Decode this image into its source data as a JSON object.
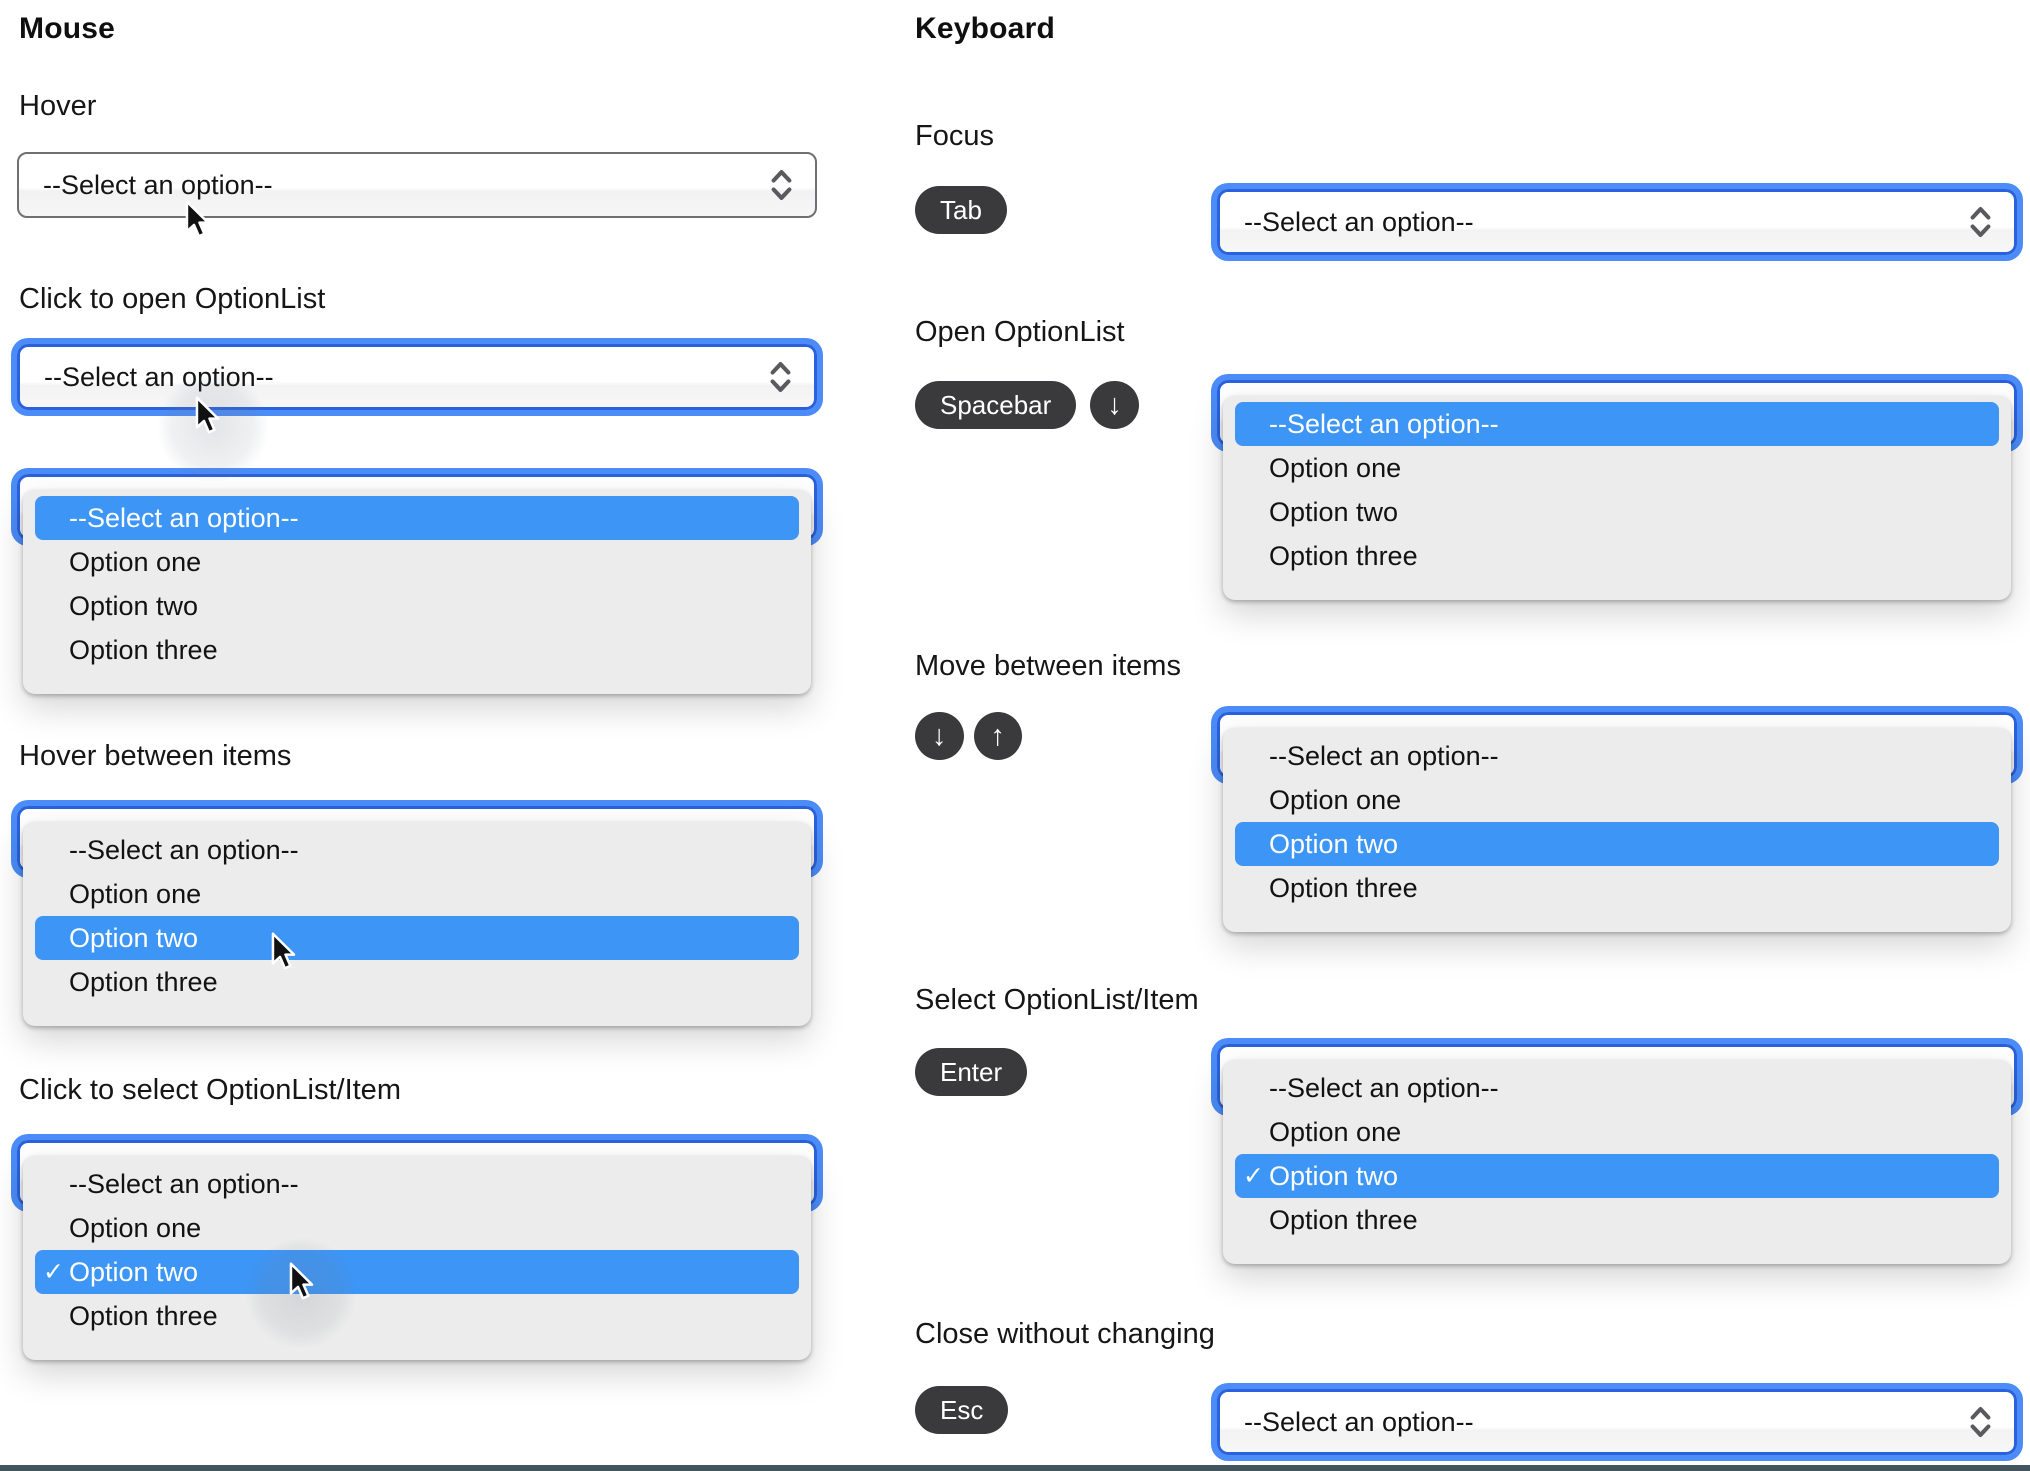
{
  "shared": {
    "placeholder": "--Select an option--",
    "options": [
      "--Select an option--",
      "Option one",
      "Option two",
      "Option three"
    ],
    "check_glyph": "✓",
    "colors": {
      "highlight": "#3d95f6",
      "focus_ring": "#4b8cf8",
      "focus_border": "#2a62dd",
      "key_bg": "#3a3a3d",
      "panel_bg": "#ececec",
      "closed_select_border": "#6f6f74",
      "bottom_bar": "#42545d"
    }
  },
  "mouse": {
    "title": "Mouse",
    "sections": {
      "hover": "Hover",
      "click_open": "Click to open OptionList",
      "hover_items": "Hover between items",
      "click_select": "Click to select OptionList/Item"
    }
  },
  "keyboard": {
    "title": "Keyboard",
    "sections": {
      "focus": "Focus",
      "open": "Open OptionList",
      "move": "Move between items",
      "select": "Select OptionList/Item",
      "close": "Close without changing"
    },
    "keys": {
      "tab": "Tab",
      "spacebar": "Spacebar",
      "down_arrow": "↓",
      "up_arrow": "↑",
      "enter": "Enter",
      "esc": "Esc"
    }
  }
}
